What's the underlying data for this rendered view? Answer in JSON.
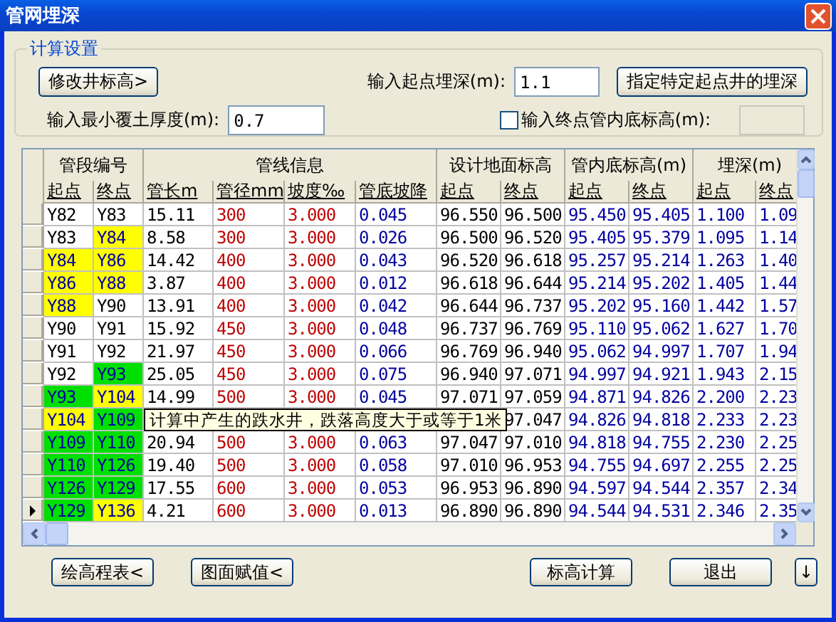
{
  "window": {
    "title": "管网埋深"
  },
  "settings": {
    "title": "计算设置",
    "modify_button": "修改井标高>",
    "start_depth_label": "输入起点埋深(m):",
    "start_depth": "1.1",
    "specify_button": "指定特定起点井的埋深",
    "min_cover_label": "输入最小覆土厚度(m):",
    "min_cover": "0.7",
    "end_invert": {
      "label": "输入终点管内底标高(m):",
      "checked": false,
      "field_disabled": true
    }
  },
  "table": {
    "groups": [
      "管段编号",
      "管线信息",
      "设计地面标高",
      "管内底标高(m)",
      "埋深(m)"
    ],
    "columns": [
      "起点",
      "终点",
      "管长m",
      "管径mm",
      "坡度‰",
      "管底坡降",
      "起点",
      "终点",
      "起点",
      "终点",
      "起点",
      "终点"
    ],
    "rows": [
      {
        "current": false,
        "cells": [
          {
            "text": "Y82",
            "color": "#ffffff"
          },
          {
            "text": "Y83",
            "color": "#ffffff"
          },
          {
            "text": "15.11"
          },
          {
            "text": "300"
          },
          {
            "text": "3.000"
          },
          {
            "text": "0.045"
          },
          {
            "text": "96.550"
          },
          {
            "text": "96.500"
          },
          {
            "text": "95.450"
          },
          {
            "text": "95.405"
          },
          {
            "text": "1.100"
          },
          {
            "text": "1.09"
          }
        ]
      },
      {
        "current": false,
        "cells": [
          {
            "text": "Y83",
            "color": "#ffffff"
          },
          {
            "text": "Y84",
            "color": "#ffff00"
          },
          {
            "text": "8.58"
          },
          {
            "text": "300"
          },
          {
            "text": "3.000"
          },
          {
            "text": "0.026"
          },
          {
            "text": "96.500"
          },
          {
            "text": "96.520"
          },
          {
            "text": "95.405"
          },
          {
            "text": "95.379"
          },
          {
            "text": "1.095"
          },
          {
            "text": "1.14"
          }
        ]
      },
      {
        "current": false,
        "cells": [
          {
            "text": "Y84",
            "color": "#ffff00"
          },
          {
            "text": "Y86",
            "color": "#ffff00"
          },
          {
            "text": "14.42"
          },
          {
            "text": "400"
          },
          {
            "text": "3.000"
          },
          {
            "text": "0.043"
          },
          {
            "text": "96.520"
          },
          {
            "text": "96.618"
          },
          {
            "text": "95.257"
          },
          {
            "text": "95.214"
          },
          {
            "text": "1.263"
          },
          {
            "text": "1.40"
          }
        ]
      },
      {
        "current": false,
        "cells": [
          {
            "text": "Y86",
            "color": "#ffff00"
          },
          {
            "text": "Y88",
            "color": "#ffff00"
          },
          {
            "text": "3.87"
          },
          {
            "text": "400"
          },
          {
            "text": "3.000"
          },
          {
            "text": "0.012"
          },
          {
            "text": "96.618"
          },
          {
            "text": "96.644"
          },
          {
            "text": "95.214"
          },
          {
            "text": "95.202"
          },
          {
            "text": "1.405"
          },
          {
            "text": "1.44"
          }
        ]
      },
      {
        "current": false,
        "cells": [
          {
            "text": "Y88",
            "color": "#ffff00"
          },
          {
            "text": "Y90",
            "color": "#ffffff"
          },
          {
            "text": "13.91"
          },
          {
            "text": "400"
          },
          {
            "text": "3.000"
          },
          {
            "text": "0.042"
          },
          {
            "text": "96.644"
          },
          {
            "text": "96.737"
          },
          {
            "text": "95.202"
          },
          {
            "text": "95.160"
          },
          {
            "text": "1.442"
          },
          {
            "text": "1.57"
          }
        ]
      },
      {
        "current": false,
        "cells": [
          {
            "text": "Y90",
            "color": "#ffffff"
          },
          {
            "text": "Y91",
            "color": "#ffffff"
          },
          {
            "text": "15.92"
          },
          {
            "text": "450"
          },
          {
            "text": "3.000"
          },
          {
            "text": "0.048"
          },
          {
            "text": "96.737"
          },
          {
            "text": "96.769"
          },
          {
            "text": "95.110"
          },
          {
            "text": "95.062"
          },
          {
            "text": "1.627"
          },
          {
            "text": "1.70"
          }
        ]
      },
      {
        "current": false,
        "cells": [
          {
            "text": "Y91",
            "color": "#ffffff"
          },
          {
            "text": "Y92",
            "color": "#ffffff"
          },
          {
            "text": "21.97"
          },
          {
            "text": "450"
          },
          {
            "text": "3.000"
          },
          {
            "text": "0.066"
          },
          {
            "text": "96.769"
          },
          {
            "text": "96.940"
          },
          {
            "text": "95.062"
          },
          {
            "text": "94.997"
          },
          {
            "text": "1.707"
          },
          {
            "text": "1.94"
          }
        ]
      },
      {
        "current": false,
        "cells": [
          {
            "text": "Y92",
            "color": "#ffffff"
          },
          {
            "text": "Y93",
            "color": "#00e000"
          },
          {
            "text": "25.05"
          },
          {
            "text": "450"
          },
          {
            "text": "3.000"
          },
          {
            "text": "0.075"
          },
          {
            "text": "96.940"
          },
          {
            "text": "97.071"
          },
          {
            "text": "94.997"
          },
          {
            "text": "94.921"
          },
          {
            "text": "1.943"
          },
          {
            "text": "2.15"
          }
        ]
      },
      {
        "current": false,
        "cells": [
          {
            "text": "Y93",
            "color": "#00e000"
          },
          {
            "text": "Y104",
            "color": "#ffff00"
          },
          {
            "text": "14.99"
          },
          {
            "text": "500"
          },
          {
            "text": "3.000"
          },
          {
            "text": "0.045"
          },
          {
            "text": "97.071"
          },
          {
            "text": "97.059"
          },
          {
            "text": "94.871"
          },
          {
            "text": "94.826"
          },
          {
            "text": "2.200"
          },
          {
            "text": "2.23"
          }
        ]
      },
      {
        "current": false,
        "cells": [
          {
            "text": "Y104",
            "color": "#ffff00"
          },
          {
            "text": "Y109",
            "color": "#00e000"
          },
          null,
          null,
          null,
          null,
          null,
          {
            "text": "97.047"
          },
          {
            "text": "94.826"
          },
          {
            "text": "94.818"
          },
          {
            "text": "2.233"
          },
          {
            "text": "2.23"
          }
        ]
      },
      {
        "current": false,
        "cells": [
          {
            "text": "Y109",
            "color": "#00e000"
          },
          {
            "text": "Y110",
            "color": "#00e000"
          },
          {
            "text": "20.94"
          },
          {
            "text": "500"
          },
          {
            "text": "3.000"
          },
          {
            "text": "0.063"
          },
          {
            "text": "97.047"
          },
          {
            "text": "97.010"
          },
          {
            "text": "94.818"
          },
          {
            "text": "94.755"
          },
          {
            "text": "2.230"
          },
          {
            "text": "2.25"
          }
        ]
      },
      {
        "current": false,
        "cells": [
          {
            "text": "Y110",
            "color": "#00e000"
          },
          {
            "text": "Y126",
            "color": "#00e000"
          },
          {
            "text": "19.40"
          },
          {
            "text": "500"
          },
          {
            "text": "3.000"
          },
          {
            "text": "0.058"
          },
          {
            "text": "97.010"
          },
          {
            "text": "96.953"
          },
          {
            "text": "94.755"
          },
          {
            "text": "94.697"
          },
          {
            "text": "2.255"
          },
          {
            "text": "2.25"
          }
        ]
      },
      {
        "current": false,
        "cells": [
          {
            "text": "Y126",
            "color": "#00e000"
          },
          {
            "text": "Y129",
            "color": "#00e000"
          },
          {
            "text": "17.55"
          },
          {
            "text": "600"
          },
          {
            "text": "3.000"
          },
          {
            "text": "0.053"
          },
          {
            "text": "96.953"
          },
          {
            "text": "96.890"
          },
          {
            "text": "94.597"
          },
          {
            "text": "94.544"
          },
          {
            "text": "2.357"
          },
          {
            "text": "2.34"
          }
        ]
      },
      {
        "current": true,
        "cells": [
          {
            "text": "Y129",
            "color": "#00e000"
          },
          {
            "text": "Y136",
            "color": "#ffff00"
          },
          {
            "text": "4.21"
          },
          {
            "text": "600"
          },
          {
            "text": "3.000"
          },
          {
            "text": "0.013"
          },
          {
            "text": "96.890"
          },
          {
            "text": "96.890"
          },
          {
            "text": "94.544"
          },
          {
            "text": "94.531"
          },
          {
            "text": "2.346"
          },
          {
            "text": "2.35"
          }
        ]
      }
    ]
  },
  "tooltip": "计算中产生的跌水井，跌落高度大于或等于1米",
  "buttons": {
    "left": [
      "绘高程表<",
      "图面赋值<"
    ],
    "right": [
      "标高计算",
      "退出"
    ],
    "arrow": "↓"
  }
}
